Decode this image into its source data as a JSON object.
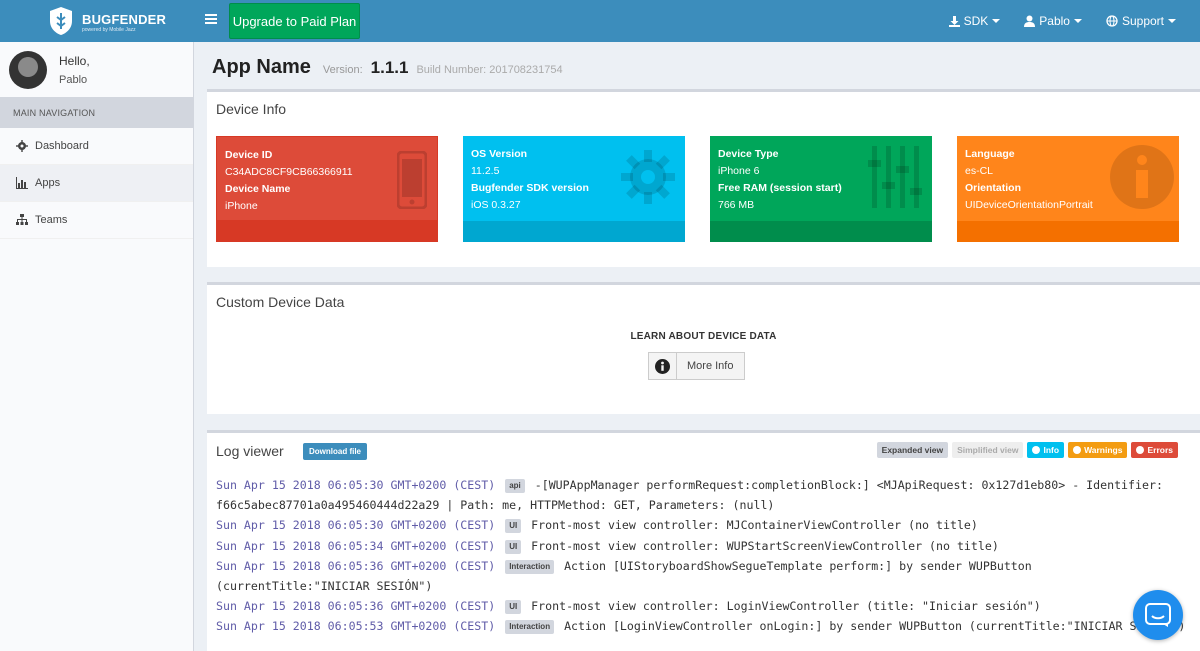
{
  "brand": {
    "name": "BUGFENDER",
    "tagline": "powered by Mobile Jazz"
  },
  "topbar": {
    "upgrade_label": "Upgrade to Paid Plan",
    "sdk_label": "SDK",
    "user_label": "Pablo",
    "support_label": "Support"
  },
  "sidebar": {
    "hello": "Hello,",
    "username": "Pablo",
    "nav_header": "MAIN NAVIGATION",
    "items": [
      {
        "label": "Dashboard",
        "icon": "dashboard-icon"
      },
      {
        "label": "Apps",
        "icon": "bar-chart-icon"
      },
      {
        "label": "Teams",
        "icon": "sitemap-icon"
      }
    ]
  },
  "app": {
    "name": "App Name",
    "version_label": "Version:",
    "version": "1.1.1",
    "build_label": "Build Number: 201708231754"
  },
  "device_info": {
    "title": "Device Info",
    "cards": [
      {
        "k1": "Device ID",
        "v1": "C34ADC8CF9CB66366911",
        "k2": "Device Name",
        "v2": "iPhone",
        "color": "#dd4b39",
        "footer": "#d73925",
        "icon": "mobile-icon"
      },
      {
        "k1": "OS Version",
        "v1": "11.2.5",
        "k2": "Bugfender SDK version",
        "v2": "iOS 0.3.27",
        "color": "#00c0ef",
        "footer": "#00a7d0",
        "icon": "gear-icon"
      },
      {
        "k1": "Device Type",
        "v1": "iPhone 6",
        "k2": "Free RAM (session start)",
        "v2": "766 MB",
        "color": "#00a65a",
        "footer": "#008d4c",
        "icon": "sliders-icon"
      },
      {
        "k1": "Language",
        "v1": "es-CL",
        "k2": "Orientation",
        "v2": "UIDeviceOrientationPortrait",
        "color": "#ff851b",
        "footer": "#f47000",
        "icon": "info-icon"
      }
    ]
  },
  "custom_data": {
    "title": "Custom Device Data",
    "learn_title": "LEARN ABOUT DEVICE DATA",
    "more_info": "More Info"
  },
  "log_viewer": {
    "title": "Log viewer",
    "download": "Download file",
    "filters": {
      "expanded": "Expanded view",
      "simplified": "Simplified view",
      "info": "Info",
      "warnings": "Warnings",
      "errors": "Errors"
    },
    "entries": [
      {
        "ts": "Sun Apr 15 2018 06:05:30 GMT+0200 (CEST)",
        "tag": "api",
        "msg": "-[WUPAppManager performRequest:completionBlock:] <MJApiRequest: 0x127d1eb80> - Identifier: f66c5abec87701a0a495460444d22a29 | Path: me, HTTPMethod: GET, Parameters: (null)"
      },
      {
        "ts": "Sun Apr 15 2018 06:05:30 GMT+0200 (CEST)",
        "tag": "UI",
        "msg": "Front-most view controller: MJContainerViewController (no title)"
      },
      {
        "ts": "Sun Apr 15 2018 06:05:34 GMT+0200 (CEST)",
        "tag": "UI",
        "msg": "Front-most view controller: WUPStartScreenViewController (no title)"
      },
      {
        "ts": "Sun Apr 15 2018 06:05:36 GMT+0200 (CEST)",
        "tag": "Interaction",
        "msg": "Action [UIStoryboardShowSegueTemplate perform:] by sender WUPButton (currentTitle:\"INICIAR SESIÓN\")"
      },
      {
        "ts": "Sun Apr 15 2018 06:05:36 GMT+0200 (CEST)",
        "tag": "UI",
        "msg": "Front-most view controller: LoginViewController (title: \"Iniciar sesión\")"
      },
      {
        "ts": "Sun Apr 15 2018 06:05:53 GMT+0200 (CEST)",
        "tag": "Interaction",
        "msg": "Action [LoginViewController onLogin:] by sender WUPButton (currentTitle:\"INICIAR SESIÓN\")"
      }
    ]
  }
}
